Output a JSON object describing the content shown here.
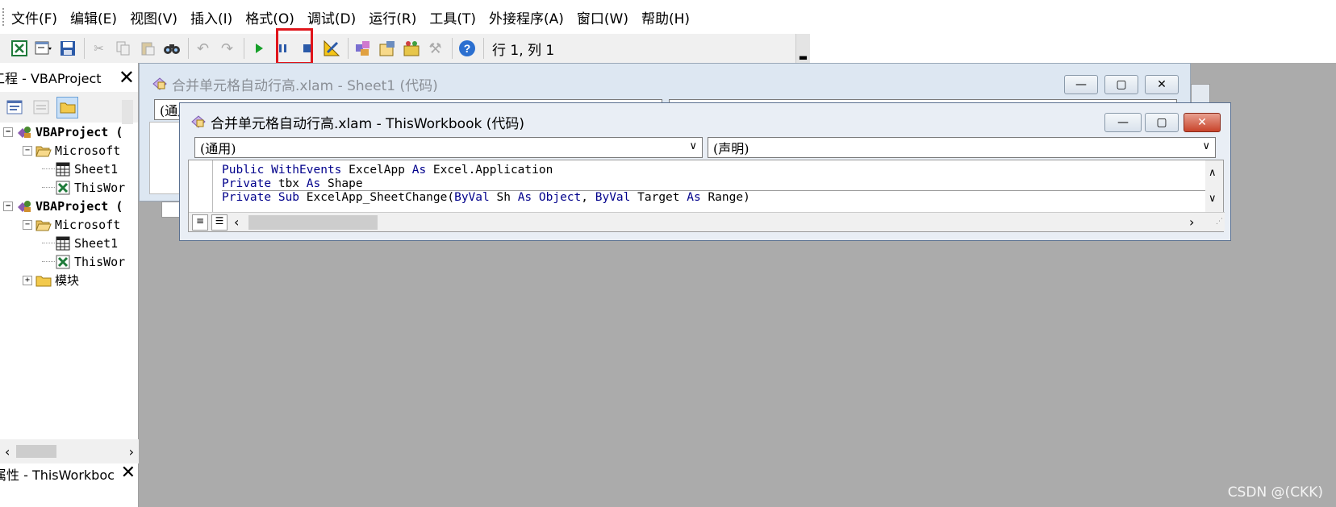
{
  "menubar": {
    "items": [
      "文件(F)",
      "编辑(E)",
      "视图(V)",
      "插入(I)",
      "格式(O)",
      "调试(D)",
      "运行(R)",
      "工具(T)",
      "外接程序(A)",
      "窗口(W)",
      "帮助(H)"
    ]
  },
  "toolbar": {
    "status": "行 1, 列 1",
    "highlight_color": "#e0151b"
  },
  "project_pane": {
    "title": "工程 - VBAProject",
    "tree": [
      {
        "label": "VBAProject (",
        "level": 0,
        "icon": "vba-project-icon",
        "bold": true,
        "expander": "⊟"
      },
      {
        "label": "Microsoft",
        "level": 1,
        "icon": "folder-open-icon",
        "bold": false,
        "expander": "⊟"
      },
      {
        "label": "Sheet1",
        "level": 2,
        "icon": "sheet-icon",
        "bold": false,
        "expander": ""
      },
      {
        "label": "ThisWor",
        "level": 2,
        "icon": "workbook-icon",
        "bold": false,
        "expander": ""
      },
      {
        "label": "VBAProject (",
        "level": 0,
        "icon": "vba-project-icon",
        "bold": true,
        "expander": "⊟"
      },
      {
        "label": "Microsoft",
        "level": 1,
        "icon": "folder-open-icon",
        "bold": false,
        "expander": "⊟"
      },
      {
        "label": "Sheet1",
        "level": 2,
        "icon": "sheet-icon",
        "bold": false,
        "expander": ""
      },
      {
        "label": "ThisWor",
        "level": 2,
        "icon": "workbook-icon",
        "bold": false,
        "expander": ""
      },
      {
        "label": "模块",
        "level": 1,
        "icon": "folder-closed-icon",
        "bold": false,
        "expander": "⊞"
      }
    ]
  },
  "properties_pane": {
    "title": "属性 - ThisWorkboc"
  },
  "back_window": {
    "title": "合并单元格自动行高.xlam - Sheet1 (代码)",
    "combo_left": "(通用)"
  },
  "front_window": {
    "title": "合并单元格自动行高.xlam - ThisWorkbook (代码)",
    "combo_left": "(通用)",
    "combo_right": "(声明)",
    "code_lines": [
      [
        {
          "t": "Public WithEvents ",
          "k": true
        },
        {
          "t": "ExcelApp ",
          "k": false
        },
        {
          "t": "As ",
          "k": true
        },
        {
          "t": "Excel.Application",
          "k": false
        }
      ],
      [
        {
          "t": "Private ",
          "k": true
        },
        {
          "t": "tbx ",
          "k": false
        },
        {
          "t": "As ",
          "k": true
        },
        {
          "t": "Shape",
          "k": false
        }
      ],
      [
        {
          "t": "Private Sub ",
          "k": true
        },
        {
          "t": "ExcelApp_SheetChange(",
          "k": false
        },
        {
          "t": "ByVal ",
          "k": true
        },
        {
          "t": "Sh ",
          "k": false
        },
        {
          "t": "As Object",
          "k": true
        },
        {
          "t": ", ",
          "k": false
        },
        {
          "t": "ByVal ",
          "k": true
        },
        {
          "t": "Target ",
          "k": false
        },
        {
          "t": "As ",
          "k": true
        },
        {
          "t": "Range)",
          "k": false
        }
      ]
    ]
  },
  "watermark": "CSDN @(CKK)"
}
